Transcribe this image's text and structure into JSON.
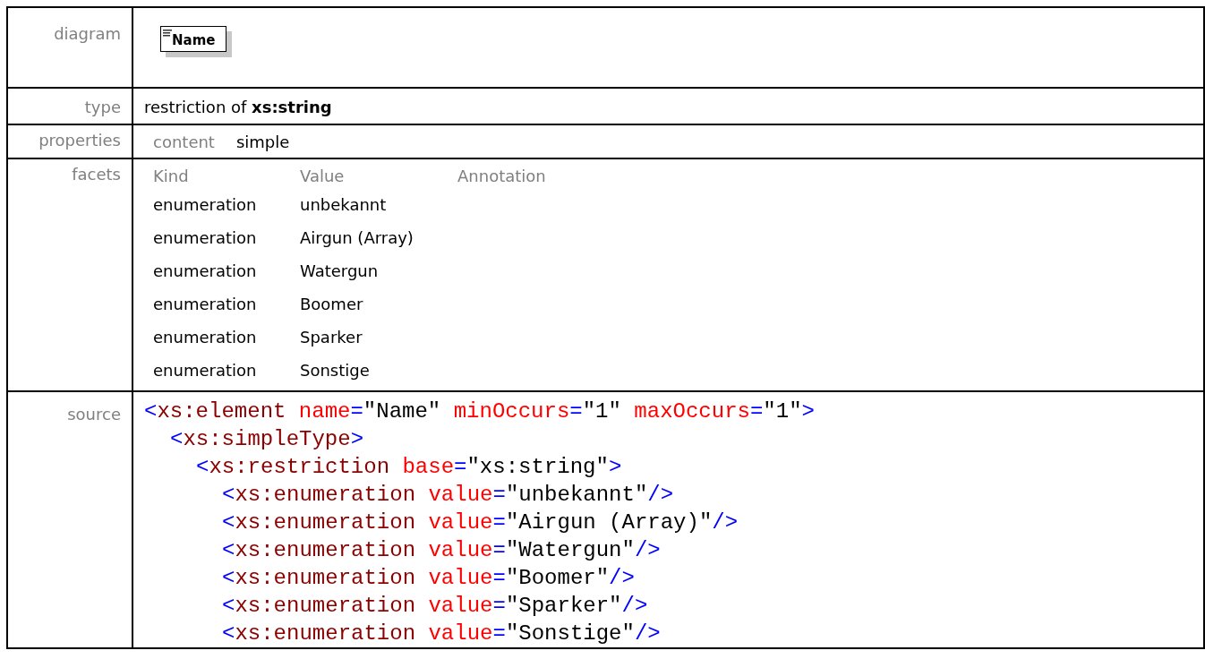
{
  "rows": [
    {
      "label": "diagram",
      "kind": "diagram",
      "element_name": "Name"
    },
    {
      "label": "type",
      "kind": "type",
      "text": "restriction of **xs:string**"
    },
    {
      "label": "properties",
      "kind": "properties",
      "items": [
        {
          "key": "content",
          "value": "simple"
        }
      ]
    },
    {
      "label": "facets",
      "kind": "facets",
      "columns": [
        "Kind",
        "Value",
        "Annotation"
      ],
      "facets": [
        {
          "kind": "enumeration",
          "value": "unbekannt"
        },
        {
          "kind": "enumeration",
          "value": "Airgun (Array)"
        },
        {
          "kind": "enumeration",
          "value": "Watergun"
        },
        {
          "kind": "enumeration",
          "value": "Boomer"
        },
        {
          "kind": "enumeration",
          "value": "Sparker"
        },
        {
          "kind": "enumeration",
          "value": "Sonstige"
        }
      ]
    },
    {
      "label": "source",
      "kind": "source",
      "lines": [
        {
          "tokens": [
            {
              "kind": "punct",
              "text": "<"
            },
            {
              "kind": "tag",
              "text": "xs:element "
            },
            {
              "kind": "attr",
              "text": "name"
            },
            {
              "kind": "punct",
              "text": "="
            },
            {
              "kind": "string",
              "text": "\"Name\" "
            },
            {
              "kind": "attr",
              "text": "minOccurs"
            },
            {
              "kind": "punct",
              "text": "="
            },
            {
              "kind": "string",
              "text": "\"1\" "
            },
            {
              "kind": "attr",
              "text": "maxOccurs"
            },
            {
              "kind": "punct",
              "text": "="
            },
            {
              "kind": "string",
              "text": "\"1\""
            },
            {
              "kind": "punct",
              "text": ">"
            }
          ],
          "children": [
            {
              "tokens": [
                {
                  "kind": "punct",
                  "text": "<"
                },
                {
                  "kind": "tag",
                  "text": "xs:simpleType"
                },
                {
                  "kind": "punct",
                  "text": ">"
                }
              ],
              "children": [
                {
                  "tokens": [
                    {
                      "kind": "punct",
                      "text": "<"
                    },
                    {
                      "kind": "tag",
                      "text": "xs:restriction "
                    },
                    {
                      "kind": "attr",
                      "text": "base"
                    },
                    {
                      "kind": "punct",
                      "text": "="
                    },
                    {
                      "kind": "string",
                      "text": "\"xs:string\""
                    },
                    {
                      "kind": "punct",
                      "text": ">"
                    }
                  ],
                  "children": [
                    {
                      "tokens": [
                        {
                          "kind": "punct",
                          "text": "<"
                        },
                        {
                          "kind": "tag",
                          "text": "xs:enumeration "
                        },
                        {
                          "kind": "attr",
                          "text": "value"
                        },
                        {
                          "kind": "punct",
                          "text": "="
                        },
                        {
                          "kind": "string",
                          "text": "\"unbekannt\""
                        },
                        {
                          "kind": "punct",
                          "text": "/>"
                        }
                      ]
                    },
                    {
                      "tokens": [
                        {
                          "kind": "punct",
                          "text": "<"
                        },
                        {
                          "kind": "tag",
                          "text": "xs:enumeration "
                        },
                        {
                          "kind": "attr",
                          "text": "value"
                        },
                        {
                          "kind": "punct",
                          "text": "="
                        },
                        {
                          "kind": "string",
                          "text": "\"Airgun (Array)\""
                        },
                        {
                          "kind": "punct",
                          "text": "/>"
                        }
                      ]
                    },
                    {
                      "tokens": [
                        {
                          "kind": "punct",
                          "text": "<"
                        },
                        {
                          "kind": "tag",
                          "text": "xs:enumeration "
                        },
                        {
                          "kind": "attr",
                          "text": "value"
                        },
                        {
                          "kind": "punct",
                          "text": "="
                        },
                        {
                          "kind": "string",
                          "text": "\"Watergun\""
                        },
                        {
                          "kind": "punct",
                          "text": "/>"
                        }
                      ]
                    },
                    {
                      "tokens": [
                        {
                          "kind": "punct",
                          "text": "<"
                        },
                        {
                          "kind": "tag",
                          "text": "xs:enumeration "
                        },
                        {
                          "kind": "attr",
                          "text": "value"
                        },
                        {
                          "kind": "punct",
                          "text": "="
                        },
                        {
                          "kind": "string",
                          "text": "\"Boomer\""
                        },
                        {
                          "kind": "punct",
                          "text": "/>"
                        }
                      ]
                    },
                    {
                      "tokens": [
                        {
                          "kind": "punct",
                          "text": "<"
                        },
                        {
                          "kind": "tag",
                          "text": "xs:enumeration "
                        },
                        {
                          "kind": "attr",
                          "text": "value"
                        },
                        {
                          "kind": "punct",
                          "text": "="
                        },
                        {
                          "kind": "string",
                          "text": "\"Sparker\""
                        },
                        {
                          "kind": "punct",
                          "text": "/>"
                        }
                      ]
                    },
                    {
                      "tokens": [
                        {
                          "kind": "punct",
                          "text": "<"
                        },
                        {
                          "kind": "tag",
                          "text": "xs:enumeration "
                        },
                        {
                          "kind": "attr",
                          "text": "value"
                        },
                        {
                          "kind": "punct",
                          "text": "="
                        },
                        {
                          "kind": "string",
                          "text": "\"Sonstige\""
                        },
                        {
                          "kind": "punct",
                          "text": "/>"
                        }
                      ]
                    }
                  ]
                }
              ]
            }
          ]
        }
      ]
    }
  ]
}
